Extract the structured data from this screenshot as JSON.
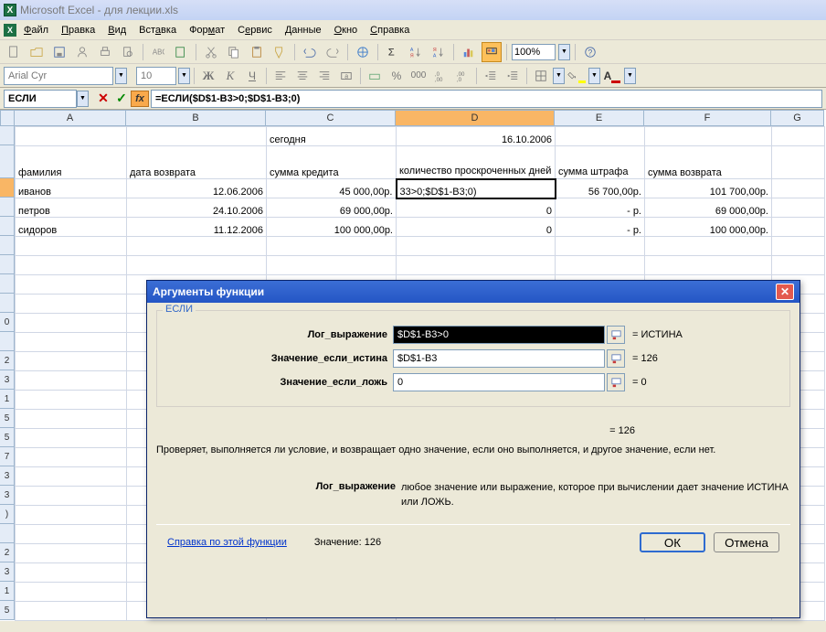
{
  "window": {
    "title": "Microsoft Excel - для лекции.xls"
  },
  "menu": {
    "file": "Файл",
    "edit": "Правка",
    "view": "Вид",
    "insert": "Вставка",
    "format": "Формат",
    "tools": "Сервис",
    "data": "Данные",
    "window": "Окно",
    "help": "Справка"
  },
  "toolbar": {
    "zoom": "100%"
  },
  "font_toolbar": {
    "font": "Arial Cyr",
    "size": "10"
  },
  "formula_bar": {
    "name_box": "ЕСЛИ",
    "formula": "=ЕСЛИ($D$1-B3>0;$D$1-B3;0)"
  },
  "columns": [
    "A",
    "B",
    "C",
    "D",
    "E",
    "F",
    "G"
  ],
  "active_column_index": 3,
  "sheet": {
    "r1": {
      "C": "сегодня",
      "D": "16.10.2006"
    },
    "r2": {
      "A": "фамилия",
      "B": "дата возврата",
      "C": "сумма кредита",
      "D": "количество проскроченных дней",
      "E": "сумма штрафа",
      "F": "сумма возврата"
    },
    "r3": {
      "A": "иванов",
      "B": "12.06.2006",
      "C": "45 000,00р.",
      "D": "33>0;$D$1-B3;0)",
      "E": "56 700,00р.",
      "F": "101 700,00р."
    },
    "r4": {
      "A": "петров",
      "B": "24.10.2006",
      "C": "69 000,00р.",
      "D": "0",
      "E": "-   р.",
      "F": "69 000,00р."
    },
    "r5": {
      "A": "сидоров",
      "B": "11.12.2006",
      "C": "100 000,00р.",
      "D": "0",
      "E": "-   р.",
      "F": "100 000,00р."
    }
  },
  "dialog": {
    "title": "Аргументы функции",
    "func": "ЕСЛИ",
    "arg1_label": "Лог_выражение",
    "arg1_value": "$D$1-B3>0",
    "arg1_result": "= ИСТИНА",
    "arg2_label": "Значение_если_истина",
    "arg2_value": "$D$1-B3",
    "arg2_result": "= 126",
    "arg3_label": "Значение_если_ложь",
    "arg3_value": "0",
    "arg3_result": "= 0",
    "result": "= 126",
    "desc": "Проверяет, выполняется ли условие, и возвращает одно значение, если оно выполняется, и другое значение, если нет.",
    "argdesc_label": "Лог_выражение",
    "argdesc_text": "любое значение или выражение, которое при вычислении дает значение ИСТИНА или ЛОЖЬ.",
    "help": "Справка по этой функции",
    "value_label": "Значение:",
    "value": "126",
    "ok": "ОК",
    "cancel": "Отмена"
  }
}
